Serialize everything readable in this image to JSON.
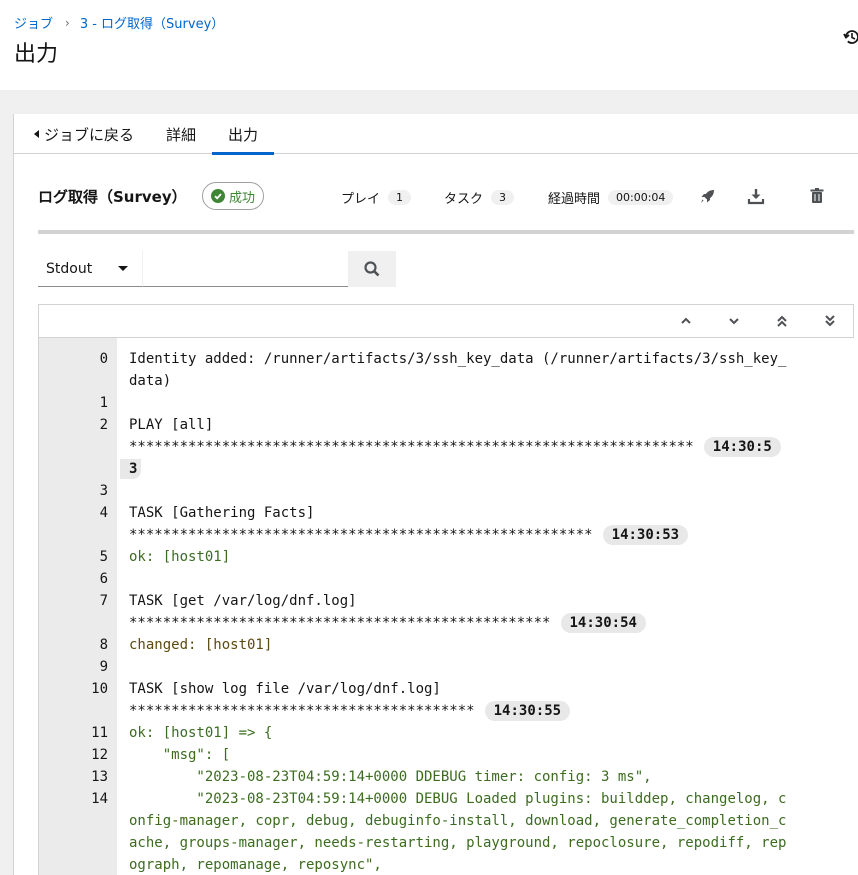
{
  "breadcrumb": {
    "jobs": "ジョブ",
    "current": "3 - ログ取得（Survey）"
  },
  "page_title": "出力",
  "tabs": [
    {
      "label": "ジョブに戻る"
    },
    {
      "label": "詳細"
    },
    {
      "label": "出力"
    }
  ],
  "output": {
    "job_name": "ログ取得（Survey）",
    "status": "成功",
    "play_label": "プレイ",
    "play_count": "1",
    "task_label": "タスク",
    "task_count": "3",
    "elapsed_label": "経過時間",
    "elapsed": "00:00:04"
  },
  "search": {
    "type_selected": "Stdout",
    "placeholder": ""
  },
  "colors": {
    "accent": "#0066cc",
    "success": "#3e8635",
    "ok_text": "#3c6c1f",
    "changed_text": "#5c4a0f"
  },
  "log": [
    {
      "n": "0",
      "text": "Identity added: /runner/artifacts/3/ssh_key_data (/runner/artifacts/3/ssh_key_",
      "style": ""
    },
    {
      "n": "",
      "text": "data)",
      "style": ""
    },
    {
      "n": "1",
      "text": "",
      "style": ""
    },
    {
      "n": "2",
      "text": "PLAY [all]",
      "style": ""
    },
    {
      "n": "",
      "text": "*******************************************************************",
      "style": "",
      "ts": "14:30:5"
    },
    {
      "n": "",
      "text": "",
      "style": "",
      "ts": "3"
    },
    {
      "n": "3",
      "text": "",
      "style": ""
    },
    {
      "n": "4",
      "text": "TASK [Gathering Facts]",
      "style": ""
    },
    {
      "n": "",
      "text": "*******************************************************",
      "style": "",
      "ts": "14:30:53"
    },
    {
      "n": "5",
      "text": "ok: [host01]",
      "style": "green"
    },
    {
      "n": "6",
      "text": "",
      "style": ""
    },
    {
      "n": "7",
      "text": "TASK [get /var/log/dnf.log]",
      "style": ""
    },
    {
      "n": "",
      "text": "**************************************************",
      "style": "",
      "ts": "14:30:54"
    },
    {
      "n": "8",
      "text": "changed: [host01]",
      "style": "brown"
    },
    {
      "n": "9",
      "text": "",
      "style": ""
    },
    {
      "n": "10",
      "text": "TASK [show log file /var/log/dnf.log]",
      "style": ""
    },
    {
      "n": "",
      "text": "*****************************************",
      "style": "",
      "ts": "14:30:55"
    },
    {
      "n": "11",
      "text": "ok: [host01] => {",
      "style": "green"
    },
    {
      "n": "12",
      "text": "    \"msg\": [",
      "style": "green"
    },
    {
      "n": "13",
      "text": "        \"2023-08-23T04:59:14+0000 DDEBUG timer: config: 3 ms\",",
      "style": "green"
    },
    {
      "n": "14",
      "text": "        \"2023-08-23T04:59:14+0000 DEBUG Loaded plugins: builddep, changelog, c",
      "style": "green"
    },
    {
      "n": "",
      "text": "onfig-manager, copr, debug, debuginfo-install, download, generate_completion_c",
      "style": "green"
    },
    {
      "n": "",
      "text": "ache, groups-manager, needs-restarting, playground, repoclosure, repodiff, rep",
      "style": "green"
    },
    {
      "n": "",
      "text": "ograph, repomanage, reposync\",",
      "style": "green"
    }
  ]
}
